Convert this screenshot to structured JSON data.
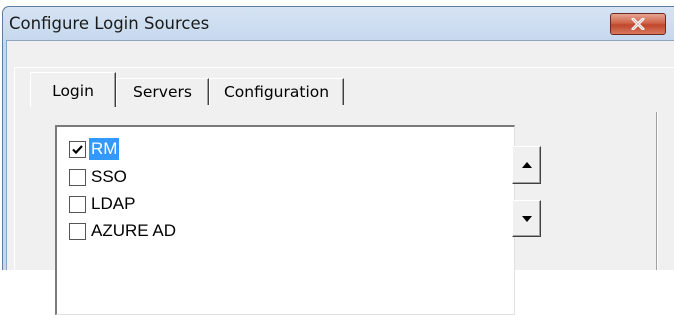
{
  "window": {
    "title": "Configure Login Sources",
    "close_icon": "close-x-icon",
    "close_color": "#c7492f"
  },
  "tabs": [
    {
      "label": "Login",
      "active": true
    },
    {
      "label": "Servers",
      "active": false
    },
    {
      "label": "Configuration",
      "active": false
    }
  ],
  "login_sources": [
    {
      "label": "RM",
      "checked": true,
      "selected": true
    },
    {
      "label": "SSO",
      "checked": false,
      "selected": false
    },
    {
      "label": "LDAP",
      "checked": false,
      "selected": false
    },
    {
      "label": "AZURE AD",
      "checked": false,
      "selected": false
    }
  ],
  "order_buttons": {
    "up_icon": "arrow-up-icon",
    "down_icon": "arrow-down-icon"
  },
  "colors": {
    "selection": "#3399ff",
    "titlebar": "#c5d7ec"
  }
}
